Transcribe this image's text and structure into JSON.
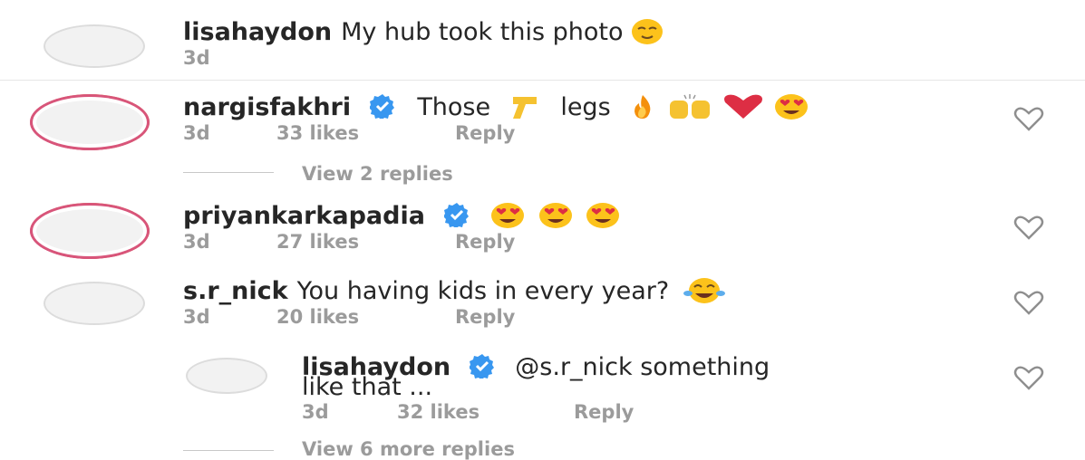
{
  "comments": [
    {
      "username": "lisahaydon",
      "text": "My hub took this photo",
      "time": "3d"
    },
    {
      "username": "nargisfakhri",
      "text_a": "Those",
      "text_b": "legs",
      "time": "3d",
      "likes": "33 likes",
      "reply": "Reply",
      "view_replies": "View 2 replies"
    },
    {
      "username": "priyankarkapadia",
      "time": "3d",
      "likes": "27 likes",
      "reply": "Reply"
    },
    {
      "username": "s.r_nick",
      "text": "You having kids in every year?",
      "time": "3d",
      "likes": "20 likes",
      "reply": "Reply"
    },
    {
      "username": "lisahaydon",
      "text_line1": "@s.r_nick something",
      "text_line2": "like that ...",
      "time": "3d",
      "likes": "32 likes",
      "reply": "Reply",
      "view_replies": "View 6 more replies"
    }
  ],
  "icons": {
    "verified": "verified-badge-icon",
    "like": "heart-outline-icon",
    "colors": {
      "verified": "#3897f0",
      "ring_start": "#f3a93f",
      "ring_end": "#cc2366",
      "meta": "#9b9b9b"
    }
  }
}
